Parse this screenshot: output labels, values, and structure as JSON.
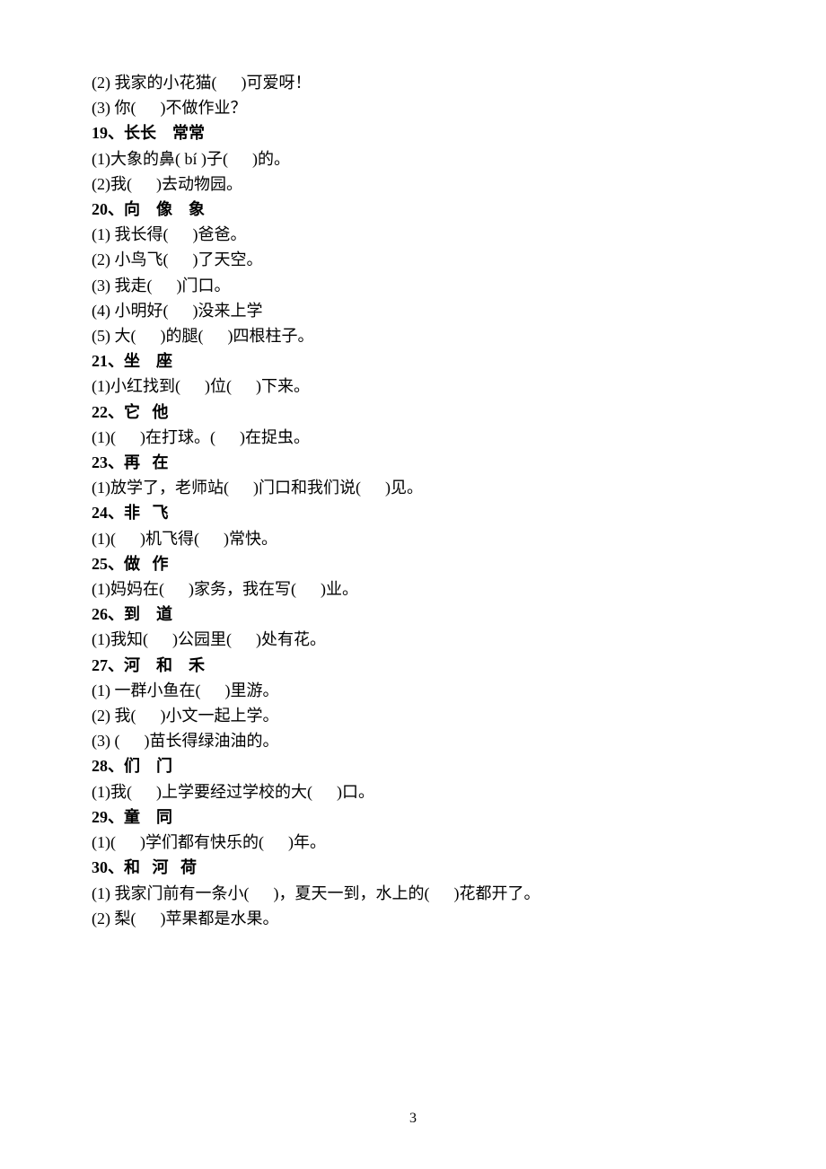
{
  "lines": [
    {
      "bold": false,
      "text": "(2) 我家的小花猫(      )可爱呀！"
    },
    {
      "bold": false,
      "text": "(3) 你(      )不做作业？"
    },
    {
      "bold": true,
      "text": "19、长长    常常"
    },
    {
      "bold": false,
      "text": "(1)大象的鼻( bí )子(      )的。"
    },
    {
      "bold": false,
      "text": "(2)我(      )去动物园。"
    },
    {
      "bold": true,
      "text": "20、向    像    象"
    },
    {
      "bold": false,
      "text": "(1) 我长得(      )爸爸。"
    },
    {
      "bold": false,
      "text": "(2) 小鸟飞(      )了天空。"
    },
    {
      "bold": false,
      "text": "(3) 我走(      )门口。"
    },
    {
      "bold": false,
      "text": "(4) 小明好(      )没来上学"
    },
    {
      "bold": false,
      "text": "(5) 大(      )的腿(      )四根柱子。"
    },
    {
      "bold": true,
      "text": "21、坐    座"
    },
    {
      "bold": false,
      "text": "(1)小红找到(      )位(      )下来。"
    },
    {
      "bold": true,
      "text": "22、它   他"
    },
    {
      "bold": false,
      "text": "(1)(      )在打球。(      )在捉虫。"
    },
    {
      "bold": true,
      "text": "23、再   在"
    },
    {
      "bold": false,
      "text": "(1)放学了，老师站(      )门口和我们说(      )见。"
    },
    {
      "bold": true,
      "text": "24、非   飞"
    },
    {
      "bold": false,
      "text": "(1)(      )机飞得(      )常快。"
    },
    {
      "bold": true,
      "text": "25、做   作"
    },
    {
      "bold": false,
      "text": "(1)妈妈在(      )家务，我在写(      )业。"
    },
    {
      "bold": true,
      "text": "26、到    道"
    },
    {
      "bold": false,
      "text": "(1)我知(      )公园里(      )处有花。"
    },
    {
      "bold": true,
      "text": "27、河    和    禾"
    },
    {
      "bold": false,
      "text": "(1) 一群小鱼在(      )里游。"
    },
    {
      "bold": false,
      "text": "(2) 我(      )小文一起上学。"
    },
    {
      "bold": false,
      "text": "(3) (      )苗长得绿油油的。"
    },
    {
      "bold": true,
      "text": "28、们    门"
    },
    {
      "bold": false,
      "text": "(1)我(      )上学要经过学校的大(      )口。"
    },
    {
      "bold": true,
      "text": "29、童    同"
    },
    {
      "bold": false,
      "text": "(1)(      )学们都有快乐的(      )年。"
    },
    {
      "bold": true,
      "text": "30、和   河   荷"
    },
    {
      "bold": false,
      "text": "(1) 我家门前有一条小(      )，夏天一到，水上的(      )花都开了。"
    },
    {
      "bold": false,
      "text": "(2) 梨(      )苹果都是水果。"
    }
  ],
  "pageNumber": "3"
}
